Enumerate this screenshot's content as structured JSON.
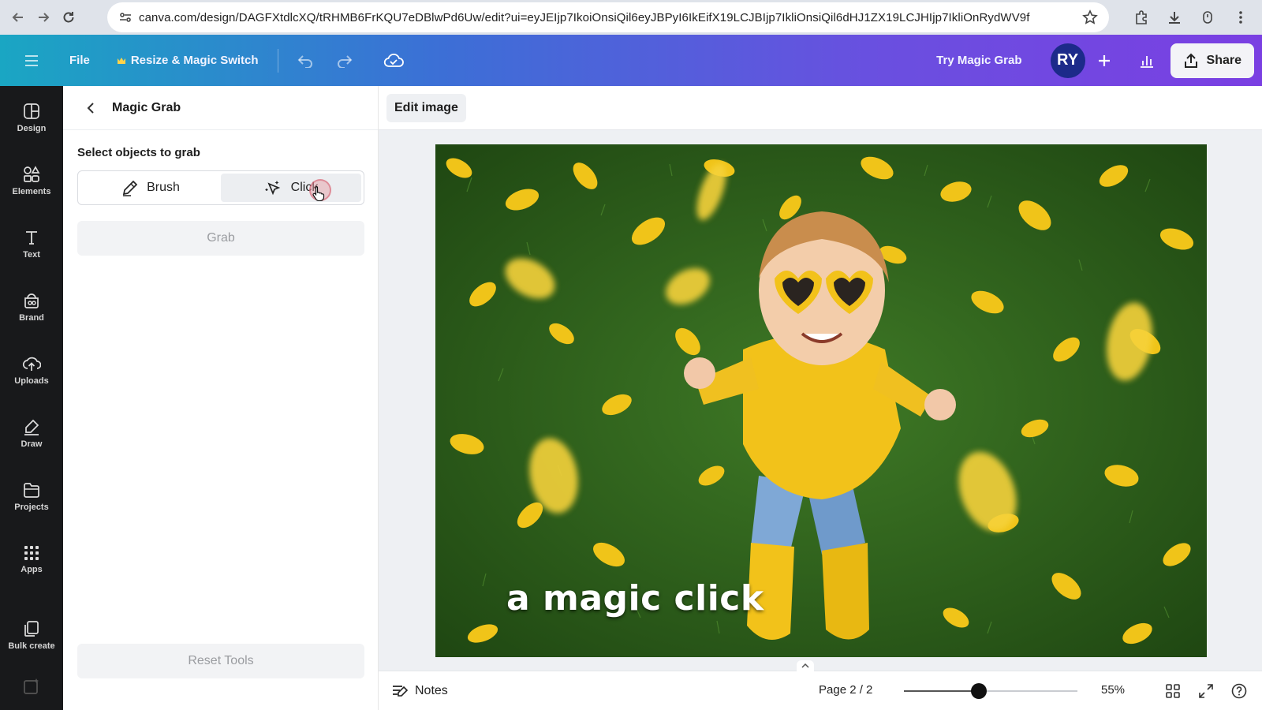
{
  "browser": {
    "url": "canva.com/design/DAGFXtdlcXQ/tRHMB6FrKQU7eDBlwPd6Uw/edit?ui=eyJEIjp7IkoiOnsiQil6eyJBPyI6IkEifX19LCJBIjp7IkliOnsiQil6dHJ1ZX19LCJHIjp7IkliOnRydWV9fQ"
  },
  "header": {
    "file_label": "File",
    "resize_label": "Resize & Magic Switch",
    "try_label": "Try Magic Grab",
    "avatar_initials": "RY",
    "share_label": "Share"
  },
  "rail": [
    {
      "label": "Design",
      "icon": "design-icon"
    },
    {
      "label": "Elements",
      "icon": "elements-icon"
    },
    {
      "label": "Text",
      "icon": "text-icon"
    },
    {
      "label": "Brand",
      "icon": "brand-icon"
    },
    {
      "label": "Uploads",
      "icon": "uploads-icon"
    },
    {
      "label": "Draw",
      "icon": "draw-icon"
    },
    {
      "label": "Projects",
      "icon": "projects-icon"
    },
    {
      "label": "Apps",
      "icon": "apps-icon"
    },
    {
      "label": "Bulk create",
      "icon": "bulk-create-icon"
    }
  ],
  "panel": {
    "title": "Magic Grab",
    "select_label": "Select objects to grab",
    "modes": [
      {
        "label": "Brush",
        "active": false
      },
      {
        "label": "Click",
        "active": true
      }
    ],
    "grab_label": "Grab",
    "reset_label": "Reset Tools"
  },
  "main": {
    "edit_image_label": "Edit image",
    "caption": "a magic click"
  },
  "bottom": {
    "notes_label": "Notes",
    "page_indicator": "Page 2 / 2",
    "zoom_label": "55%",
    "zoom_fraction": 0.43
  },
  "colors": {
    "header_gradient_start": "#1aa6c3",
    "header_gradient_end": "#7a3fe2",
    "rail_bg": "#18191b",
    "avatar_bg": "#1c2a8a",
    "grass": "#2d5c1e",
    "leaf": "#f0c419",
    "sweater": "#f2c21a"
  }
}
